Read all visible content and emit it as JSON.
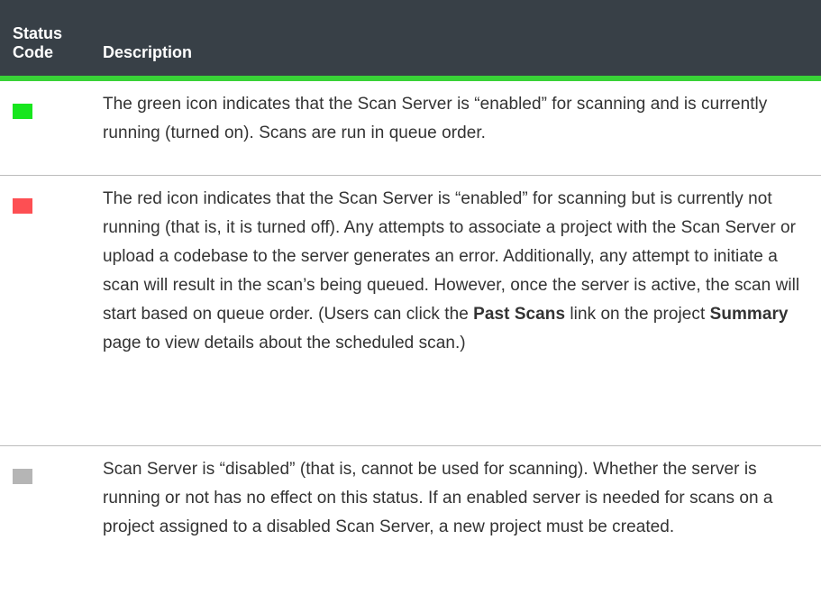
{
  "table": {
    "headers": {
      "status_code": "Status\nCode",
      "description": "Description"
    },
    "rows": [
      {
        "icon": "green-status-icon",
        "color": "#18e61e",
        "text": "The green icon indicates that the Scan Server is “enabled” for scanning and is currently running (turned on). Scans are run in queue order."
      },
      {
        "icon": "red-status-icon",
        "color": "#fd4f53",
        "text_a": "The red icon indicates that the Scan Server is “enabled” for scanning but is currently not running (that is, it is turned off). Any attempts to associate a project with the Scan Server or upload a codebase to the server generates an error. Additionally, any attempt to initiate a scan will result in the scan’s being queued. However, once the server is active, the scan will start based on queue order. (Users can click the ",
        "bold_a": "Past Scans",
        "text_b": " link on the project ",
        "bold_b": "Summary",
        "text_c": " page to view details about the scheduled scan.)"
      },
      {
        "icon": "grey-status-icon",
        "color": "#b5b5b5",
        "text": "Scan Server is “disabled” (that is, cannot be used for scanning). Whether the server is running or not has no effect on this status. If an enabled server is needed for scans on a project assigned to a disabled Scan Server, a new project must be created."
      }
    ]
  }
}
